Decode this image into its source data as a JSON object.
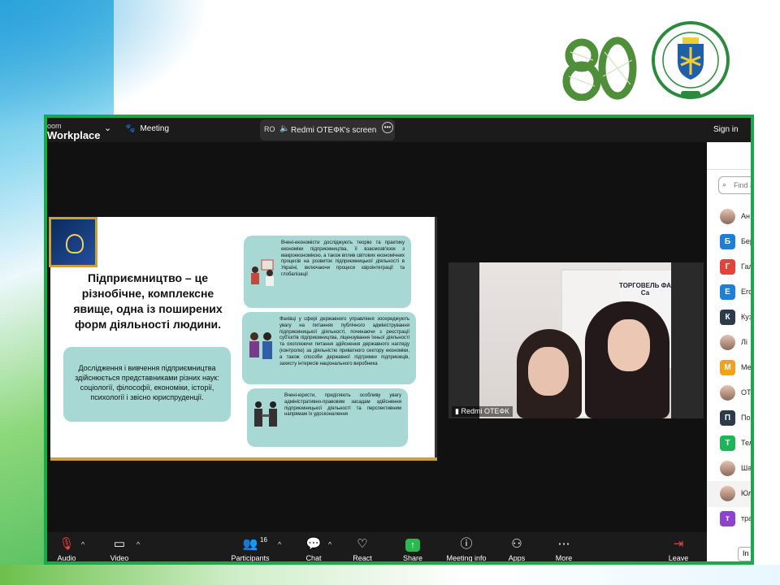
{
  "window": {
    "brand_small": "oom",
    "brand_big": "Workplace",
    "meeting_label": "Meeting",
    "share_initials": "RO",
    "share_label": "Redmi ОТЕФК's screen",
    "sign_in": "Sign in"
  },
  "slide": {
    "title": "Підприємництво – це різнобічне, комплексне явище, одна із поширених форм діяльності людини.",
    "left_box": "Дослідження і вивчення підприємництва здійснюється представниками різних наук: соціології, філософії, економіки, історії, психології і звісно юриспруденції.",
    "card1": "Вчені-економісти досліджують теорію та практику економіки підприємництва, її взаємозв'язок з макроекономікою, а також вплив світових економічних процесів на розвиток підприємницької діяльності в Україні, включаючи процеси євроінтеграції та глобалізації",
    "card2": "Фахівці у сфері державного управління зосереджують увагу на питаннях публічного адміністрування підприємницької діяльності, починаючи з реєстрації суб'єктів підприємництва, ліцензування їхньої діяльності та охоплюючи питання здійснення державного нагляду (контролю) за діяльністю приватного сектору економіки, а також способи державної підтримки підприємців, захисту інтересів національного виробника",
    "card3": "Вчені-юристи, приділяють особливу увагу адміністративно-правовим засадам здійснення підприємницької діяльності та перспективним напрямам їх удосконалення"
  },
  "video": {
    "name_label": "Redmi ОТЕФК",
    "banner_text": "ТОРГОВЕЛЬ ФА Са"
  },
  "participants": {
    "search_placeholder": "Find a",
    "items": [
      {
        "initial": "",
        "label": "Ан",
        "color": "#ffffff",
        "photo": true
      },
      {
        "initial": "Б",
        "label": "Бер",
        "color": "#1e7fd6",
        "photo": false
      },
      {
        "initial": "Г",
        "label": "Гал",
        "color": "#e0443a",
        "photo": false
      },
      {
        "initial": "Е",
        "label": "Его",
        "color": "#1e7fd6",
        "photo": false
      },
      {
        "initial": "К",
        "label": "Куз",
        "color": "#2d3a4a",
        "photo": false
      },
      {
        "initial": "",
        "label": "Лі",
        "color": "#ffffff",
        "photo": true
      },
      {
        "initial": "М",
        "label": "Ме",
        "color": "#f2a11a",
        "photo": false
      },
      {
        "initial": "",
        "label": "ОТ",
        "color": "#ffffff",
        "photo": true
      },
      {
        "initial": "П",
        "label": "По",
        "color": "#2d3a4a",
        "photo": false
      },
      {
        "initial": "Т",
        "label": "Тел",
        "color": "#1fb45a",
        "photo": false
      },
      {
        "initial": "",
        "label": "Ша",
        "color": "#ffffff",
        "photo": true
      },
      {
        "initial": "",
        "label": "Юл",
        "color": "#ffffff",
        "photo": true,
        "selected": true
      },
      {
        "initial": "т",
        "label": "тра",
        "color": "#8e44c9",
        "photo": false
      }
    ],
    "invite": "In"
  },
  "toolbar": {
    "audio": "Audio",
    "video": "Video",
    "participants": "Participants",
    "participants_count": "16",
    "chat": "Chat",
    "react": "React",
    "share": "Share",
    "meeting_info": "Meeting info",
    "apps": "Apps",
    "more": "More",
    "leave": "Leave"
  },
  "colors": {
    "frame_green": "#19a84a",
    "card_teal": "#a7d8d4",
    "share_green": "#2ab84f"
  }
}
